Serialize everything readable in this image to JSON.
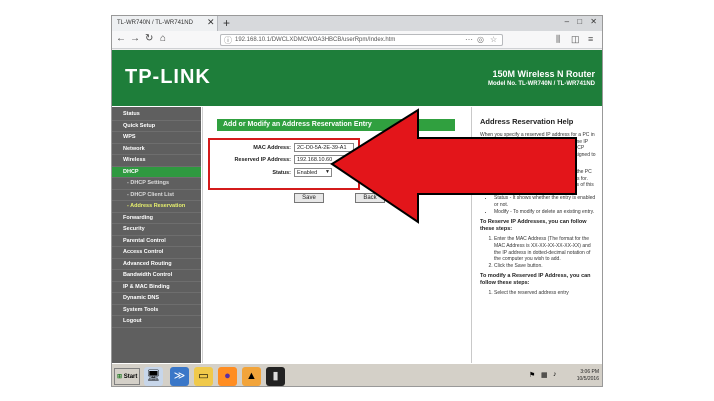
{
  "browser": {
    "tab_title": "TL-WR740N / TL-WR741ND",
    "new_tab": "+",
    "close_tab": "✕",
    "window_controls": "– □ ✕",
    "url": "192.168.10.1/DWCLXDMCWOA3HBCB/userRpm/Index.htm"
  },
  "header": {
    "logo": "TP-LINK",
    "model_title": "150M Wireless N Router",
    "model_number": "Model No. TL-WR740N / TL-WR741ND"
  },
  "sidebar": {
    "items": [
      {
        "label": "Status",
        "type": "main"
      },
      {
        "label": "Quick Setup",
        "type": "main"
      },
      {
        "label": "WPS",
        "type": "main"
      },
      {
        "label": "Network",
        "type": "main"
      },
      {
        "label": "Wireless",
        "type": "main"
      },
      {
        "label": "DHCP",
        "type": "active"
      },
      {
        "label": "- DHCP Settings",
        "type": "sub"
      },
      {
        "label": "- DHCP Client List",
        "type": "sub"
      },
      {
        "label": "- Address Reservation",
        "type": "current"
      },
      {
        "label": "Forwarding",
        "type": "main"
      },
      {
        "label": "Security",
        "type": "main"
      },
      {
        "label": "Parental Control",
        "type": "main"
      },
      {
        "label": "Access Control",
        "type": "main"
      },
      {
        "label": "Advanced Routing",
        "type": "main"
      },
      {
        "label": "Bandwidth Control",
        "type": "main"
      },
      {
        "label": "IP & MAC Binding",
        "type": "main"
      },
      {
        "label": "Dynamic DNS",
        "type": "main"
      },
      {
        "label": "System Tools",
        "type": "main"
      },
      {
        "label": "Logout",
        "type": "main"
      }
    ]
  },
  "content": {
    "section_title": "Add or Modify an Address Reservation Entry",
    "mac_label": "MAC Address:",
    "mac_value": "2C-D0-5A-2E-39-A1",
    "ip_label": "Reserved IP Address:",
    "ip_value": "192.168.10.60",
    "status_label": "Status:",
    "status_value": "Enabled",
    "save_label": "Save",
    "back_label": "Back"
  },
  "help": {
    "title": "Address Reservation Help",
    "intro": "When you specify a reserved IP address for a PC in the LAN, that PC will always receive the same IP address each time when it accesses the DHCP server. Reserved IP addresses could be assigned to servers that require permanent IP settings.",
    "bullets": [
      "MAC Address - The MAC Address of the PC that you want to reserve an IP address for.",
      "Reserved IP Address - The IP address of this device reserved.",
      "Status - It shows whether the entry is enabled or not.",
      "Modify - To modify or delete an existing entry."
    ],
    "reserve_heading": "To Reserve IP Addresses, you can follow these steps:",
    "reserve_steps": [
      "Enter the MAC Address (The format for the MAC Address is XX-XX-XX-XX-XX-XX) and the IP address in dotted-decimal notation of the computer you wish to add.",
      "Click the Save button."
    ],
    "modify_heading": "To modify a Reserved IP Address, you can follow these steps:",
    "modify_steps": [
      "Select the reserved address entry"
    ]
  },
  "taskbar": {
    "start_label": "Start",
    "time": "3:06 PM",
    "date": "10/5/2016"
  },
  "colors": {
    "header_green": "#1e7e3a",
    "title_green": "#30a03f",
    "sidebar_gray": "#5f5f5f",
    "arrow_red": "#e3151a"
  }
}
